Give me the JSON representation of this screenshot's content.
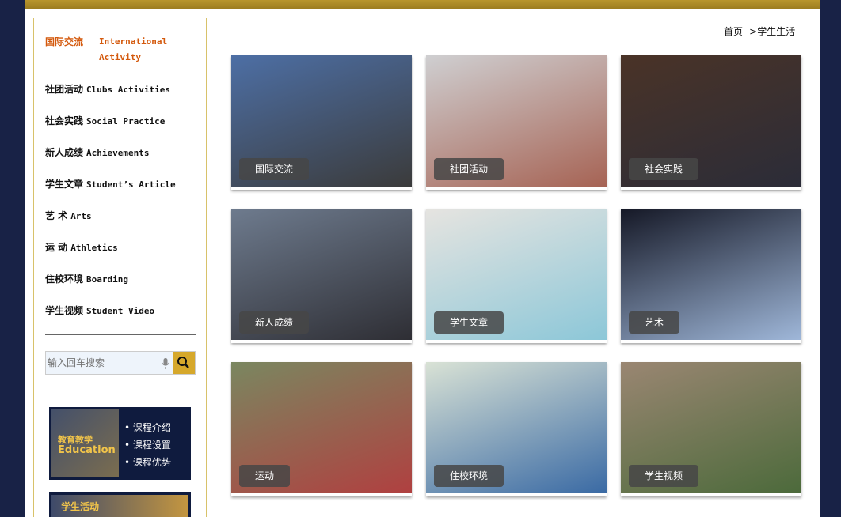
{
  "sidebar": {
    "items": [
      {
        "zh": "国际交流",
        "en": "International Activity",
        "active": true
      },
      {
        "zh": "社团活动",
        "en": "Clubs Activities",
        "active": false
      },
      {
        "zh": "社会实践",
        "en": "Social Practice",
        "active": false
      },
      {
        "zh": "新人成绩",
        "en": "Achievements",
        "active": false
      },
      {
        "zh": "学生文章",
        "en": "Student’s Article",
        "active": false
      },
      {
        "zh": "艺 术",
        "en": "Arts",
        "active": false
      },
      {
        "zh": "运 动",
        "en": "Athletics",
        "active": false
      },
      {
        "zh": "住校环境",
        "en": "Boarding",
        "active": false
      },
      {
        "zh": "学生视频",
        "en": "Student Video",
        "active": false
      }
    ],
    "search": {
      "placeholder": "输入回车搜索"
    },
    "banner1": {
      "title_zh": "教育教学",
      "title_en": "Education",
      "links": [
        "课程介绍",
        "课程设置",
        "课程优势"
      ]
    },
    "banner2": {
      "title_zh": "学生活动"
    }
  },
  "breadcrumb": {
    "home": "首页",
    "sep": " ->",
    "current": "学生生活"
  },
  "tiles": [
    {
      "label": "国际交流",
      "colors": [
        "#4d6fa5",
        "#3b3b3b"
      ]
    },
    {
      "label": "社团活动",
      "colors": [
        "#cfcfd1",
        "#a66354"
      ]
    },
    {
      "label": "社会实践",
      "colors": [
        "#4a3327",
        "#2b2c38"
      ]
    },
    {
      "label": "新人成绩",
      "colors": [
        "#6e7b8e",
        "#2e2e34"
      ]
    },
    {
      "label": "学生文章",
      "colors": [
        "#e6e4e0",
        "#8cc7d8"
      ]
    },
    {
      "label": "艺术",
      "colors": [
        "#151826",
        "#9fb7d9"
      ]
    },
    {
      "label": "运动",
      "colors": [
        "#7a8760",
        "#b04040"
      ]
    },
    {
      "label": "住校环境",
      "colors": [
        "#d9e2d5",
        "#3a6aa4"
      ]
    },
    {
      "label": "学生视频",
      "colors": [
        "#9a8672",
        "#4c6a3b"
      ]
    }
  ],
  "colors": {
    "background": "#182246",
    "accent_gold": "#b8952d",
    "active_nav": "#d45a0e"
  }
}
